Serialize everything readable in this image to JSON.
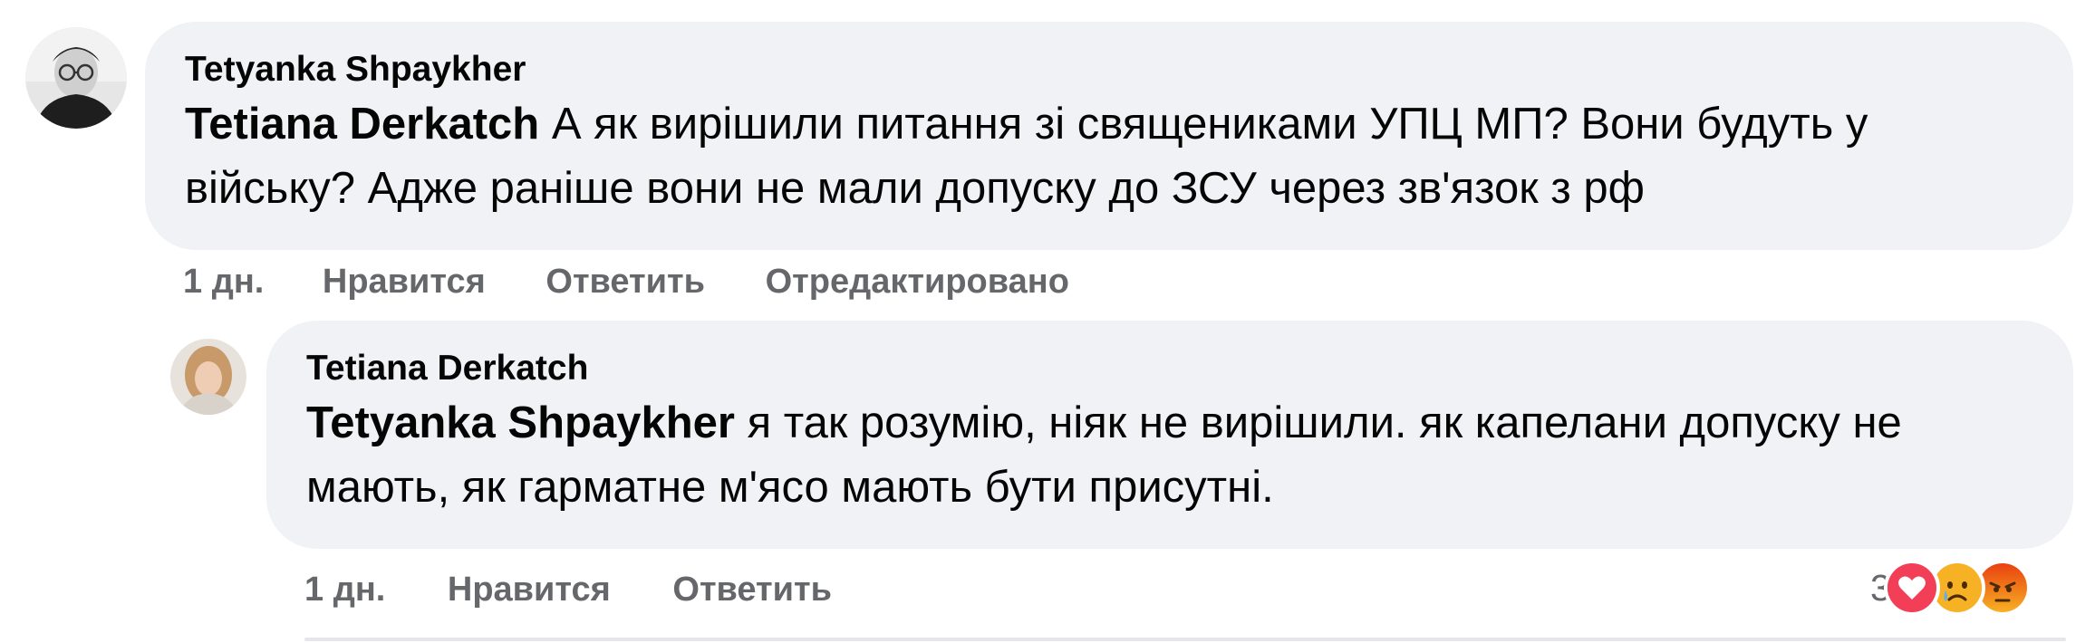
{
  "comment": {
    "author": "Tetyanka Shpaykher",
    "mention": "Tetiana Derkatch",
    "body": " А як вирішили питання зі священиками УПЦ МП? Вони будуть у війську? Адже раніше вони не мали допуску до ЗСУ через зв'язок з рф",
    "time": "1 дн.",
    "like_label": "Нравится",
    "reply_label": "Ответить",
    "edited_label": "Отредактировано"
  },
  "reply": {
    "author": "Tetiana Derkatch",
    "mention": "Tetyanka Shpaykher",
    "body": " я так розумію, ніяк не вирішили. як капелани допуску не мають, як гарматне м'ясо мають бути присутні.",
    "time": "1 дн.",
    "like_label": "Нравится",
    "reply_label": "Ответить",
    "reactions": {
      "count": "3",
      "icons": [
        "heart-reaction-icon",
        "sad-reaction-icon",
        "angry-reaction-icon"
      ]
    }
  },
  "colors": {
    "bubble": "#f0f2f5",
    "meta_text": "#65676b",
    "heart": "#f33e58",
    "emoji_yellow": "#f7b125",
    "angry": "#e9710f"
  }
}
